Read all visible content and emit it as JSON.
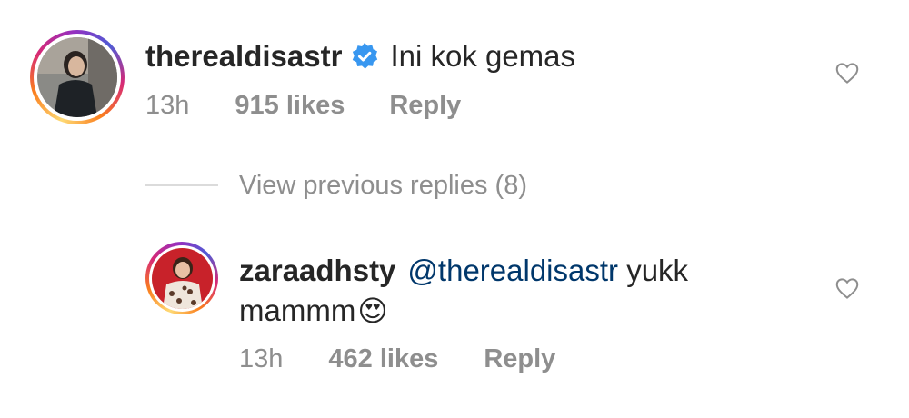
{
  "comment": {
    "username": "therealdisastr",
    "verified": true,
    "text": "Ini kok gemas",
    "time": "13h",
    "likes": "915 likes",
    "reply_label": "Reply"
  },
  "view_replies": {
    "label": "View previous replies (8)"
  },
  "reply": {
    "username": "zaraadhsty",
    "mention": "@therealdisastr",
    "text_line1": " yukk",
    "text_line2": "mammm",
    "emoji": "😍",
    "time": "13h",
    "likes": "462 likes",
    "reply_label": "Reply"
  },
  "colors": {
    "verified_badge": "#3897f0",
    "mention": "#00376b",
    "muted": "#8e8e8e"
  }
}
